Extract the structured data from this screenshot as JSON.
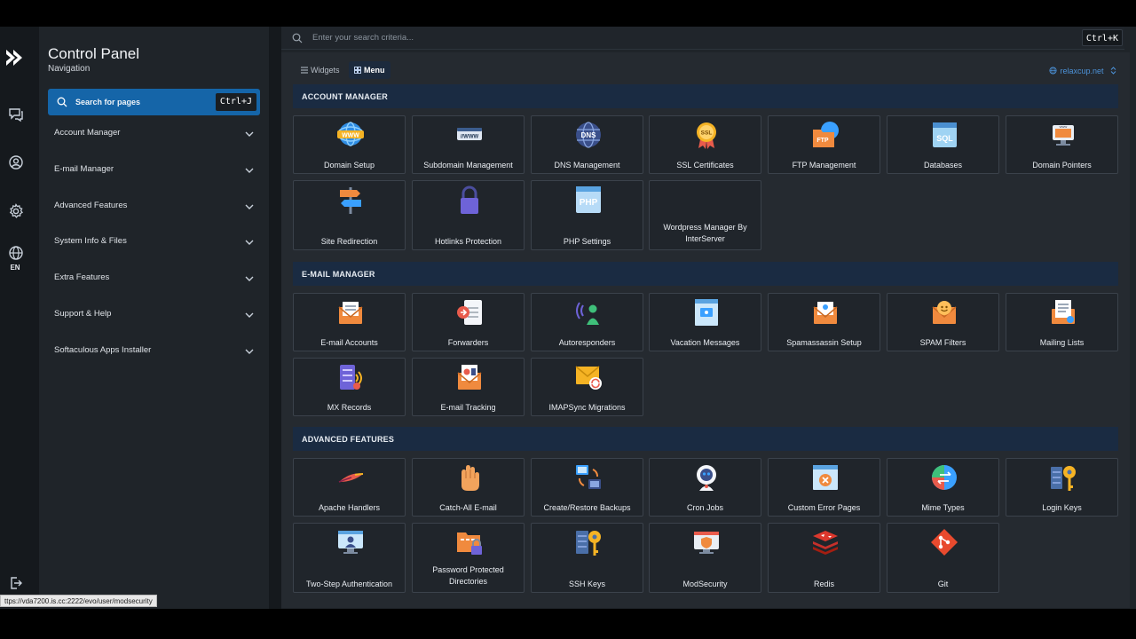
{
  "sidebar_rail": {
    "language": "EN"
  },
  "nav": {
    "title": "Control Panel",
    "subtitle": "Navigation",
    "search_label": "Search for pages",
    "search_shortcut": "Ctrl+J",
    "items": [
      {
        "label": "Account Manager"
      },
      {
        "label": "E-mail Manager"
      },
      {
        "label": "Advanced Features"
      },
      {
        "label": "System Info & Files"
      },
      {
        "label": "Extra Features"
      },
      {
        "label": "Support & Help"
      },
      {
        "label": "Softaculous Apps Installer"
      }
    ]
  },
  "top_search": {
    "placeholder": "Enter your search criteria...",
    "shortcut": "Ctrl+K"
  },
  "view_tabs": {
    "widgets": "Widgets",
    "menu": "Menu",
    "active": "Menu"
  },
  "domain_selector": "relaxcup.net",
  "sections": [
    {
      "title": "ACCOUNT MANAGER",
      "tiles": [
        {
          "label": "Domain Setup",
          "icon": "globe-www-icon"
        },
        {
          "label": "Subdomain Management",
          "icon": "subdomain-icon"
        },
        {
          "label": "DNS Management",
          "icon": "dns-globe-icon"
        },
        {
          "label": "SSL Certificates",
          "icon": "ssl-badge-icon"
        },
        {
          "label": "FTP Management",
          "icon": "ftp-folder-icon"
        },
        {
          "label": "Databases",
          "icon": "sql-database-icon"
        },
        {
          "label": "Domain Pointers",
          "icon": "domain-pointer-icon"
        },
        {
          "label": "Site Redirection",
          "icon": "signpost-icon"
        },
        {
          "label": "Hotlinks Protection",
          "icon": "padlock-icon"
        },
        {
          "label": "PHP Settings",
          "icon": "php-icon"
        },
        {
          "label": "Wordpress Manager By InterServer",
          "icon": ""
        }
      ]
    },
    {
      "title": "E-MAIL MANAGER",
      "tiles": [
        {
          "label": "E-mail Accounts",
          "icon": "email-envelope-icon"
        },
        {
          "label": "Forwarders",
          "icon": "forwarder-icon"
        },
        {
          "label": "Autoresponders",
          "icon": "autoresponder-icon"
        },
        {
          "label": "Vacation Messages",
          "icon": "vacation-message-icon"
        },
        {
          "label": "Spamassassin Setup",
          "icon": "spam-envelope-icon"
        },
        {
          "label": "SPAM Filters",
          "icon": "spam-filter-icon"
        },
        {
          "label": "Mailing Lists",
          "icon": "mailing-list-icon"
        },
        {
          "label": "MX Records",
          "icon": "mx-records-icon"
        },
        {
          "label": "E-mail Tracking",
          "icon": "email-tracking-icon"
        },
        {
          "label": "IMAPSync Migrations",
          "icon": "imap-sync-icon"
        }
      ]
    },
    {
      "title": "ADVANCED FEATURES",
      "tiles": [
        {
          "label": "Apache Handlers",
          "icon": "apache-feather-icon"
        },
        {
          "label": "Catch-All E-mail",
          "icon": "catch-hand-icon"
        },
        {
          "label": "Create/Restore Backups",
          "icon": "backup-icon"
        },
        {
          "label": "Cron Jobs",
          "icon": "cron-robot-icon"
        },
        {
          "label": "Custom Error Pages",
          "icon": "error-page-icon"
        },
        {
          "label": "Mime Types",
          "icon": "mime-types-icon"
        },
        {
          "label": "Login Keys",
          "icon": "login-key-icon"
        },
        {
          "label": "Two-Step Authentication",
          "icon": "two-step-auth-icon"
        },
        {
          "label": "Password Protected Directories",
          "icon": "protected-folder-icon"
        },
        {
          "label": "SSH Keys",
          "icon": "ssh-key-icon"
        },
        {
          "label": "ModSecurity",
          "icon": "modsecurity-icon"
        },
        {
          "label": "Redis",
          "icon": "redis-icon"
        },
        {
          "label": "Git",
          "icon": "git-icon"
        }
      ]
    }
  ],
  "status_url": "ttps://vda7200.is.cc:2222/evo/user/modsecurity",
  "colors": {
    "accent": "#1565a8",
    "section_bar": "#1a2b42",
    "link": "#4c92d8"
  }
}
